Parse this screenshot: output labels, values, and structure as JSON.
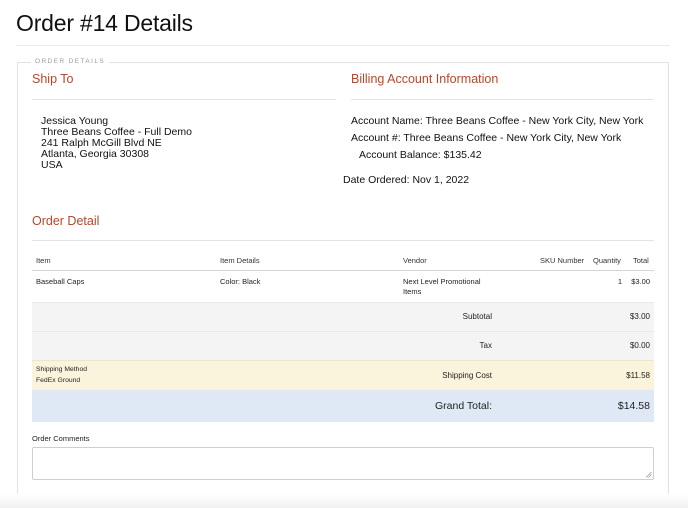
{
  "page": {
    "title": "Order #14 Details"
  },
  "fieldset": {
    "legend": "ORDER DETAILS"
  },
  "ship_to": {
    "heading": "Ship To",
    "lines": [
      "Jessica Young",
      "Three Beans Coffee - Full Demo",
      "241 Ralph McGill Blvd NE",
      "Atlanta, Georgia 30308",
      "USA"
    ]
  },
  "billing": {
    "heading": "Billing Account Information",
    "account_name": "Account Name: Three Beans Coffee - New York City, New York",
    "account_number": "Account #: Three Beans Coffee - New York City, New York",
    "account_balance": "Account Balance: $135.42",
    "date_ordered": "Date Ordered: Nov 1, 2022"
  },
  "order_detail": {
    "heading": "Order Detail",
    "columns": [
      "Item",
      "Item Details",
      "Vendor",
      "SKU Number",
      "Quantity",
      "Total"
    ],
    "rows": [
      {
        "item": "Baseball Caps",
        "details": "Color: Black",
        "vendor_line1": "Next Level Promotional",
        "vendor_line2": "Items",
        "sku": "",
        "quantity": "1",
        "total": "$3.00"
      }
    ],
    "subtotal_label": "Subtotal",
    "subtotal_value": "$3.00",
    "tax_label": "Tax",
    "tax_value": "$0.00",
    "shipping_method_label": "Shipping Method",
    "shipping_method_value": "FedEx Ground",
    "shipping_cost_label": "Shipping Cost",
    "shipping_cost_value": "$11.58",
    "grand_total_label": "Grand Total:",
    "grand_total_value": "$14.58"
  },
  "comments": {
    "label": "Order Comments",
    "value": ""
  },
  "colors": {
    "accent": "#b5472c",
    "shipping_band": "#fbf4dc",
    "grand_band": "#dfe9f5",
    "row_band": "#f4f4f4"
  }
}
